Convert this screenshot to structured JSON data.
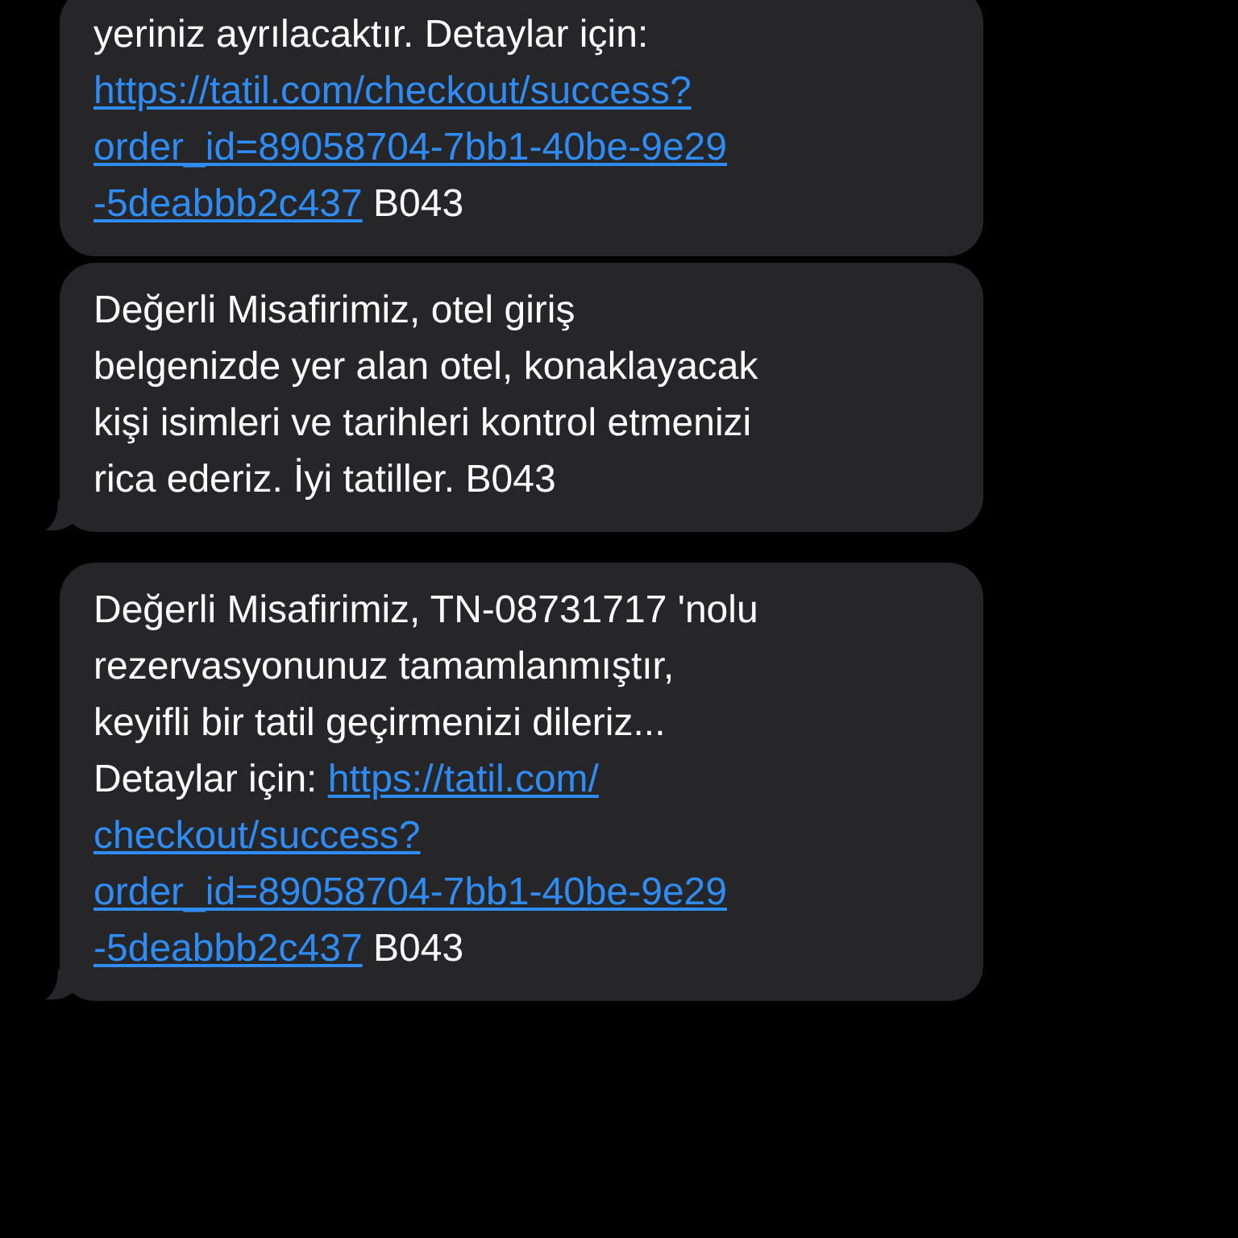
{
  "messages": [
    {
      "tail": false,
      "lines": [
        [
          {
            "kind": "text",
            "text": "yeriniz ayrılacaktır. Detaylar için:"
          }
        ],
        [
          {
            "kind": "link",
            "text": "https://tatil.com/checkout/success?"
          }
        ],
        [
          {
            "kind": "link",
            "text": "order_id=89058704-7bb1-40be-9e29"
          }
        ],
        [
          {
            "kind": "link",
            "text": "-5deabbb2c437"
          },
          {
            "kind": "text",
            "text": " B043"
          }
        ]
      ]
    },
    {
      "tail": true,
      "lines": [
        [
          {
            "kind": "text",
            "text": "Değerli Misafirimiz, otel giriş"
          }
        ],
        [
          {
            "kind": "text",
            "text": "belgenizde yer alan otel, konaklayacak"
          }
        ],
        [
          {
            "kind": "text",
            "text": "kişi isimleri ve tarihleri kontrol etmenizi"
          }
        ],
        [
          {
            "kind": "text",
            "text": "rica ederiz. İyi tatiller. B043"
          }
        ]
      ]
    },
    {
      "tail": true,
      "lines": [
        [
          {
            "kind": "text",
            "text": "Değerli Misafirimiz, TN-08731717 'nolu"
          }
        ],
        [
          {
            "kind": "text",
            "text": "rezervasyonunuz tamamlanmıştır,"
          }
        ],
        [
          {
            "kind": "text",
            "text": "keyifli bir tatil geçirmenizi dileriz..."
          }
        ],
        [
          {
            "kind": "text",
            "text": "Detaylar için: "
          },
          {
            "kind": "link",
            "text": "https://tatil.com/"
          }
        ],
        [
          {
            "kind": "link",
            "text": "checkout/success?"
          }
        ],
        [
          {
            "kind": "link",
            "text": "order_id=89058704-7bb1-40be-9e29"
          }
        ],
        [
          {
            "kind": "link",
            "text": "-5deabbb2c437"
          },
          {
            "kind": "text",
            "text": " B043"
          }
        ]
      ]
    }
  ]
}
